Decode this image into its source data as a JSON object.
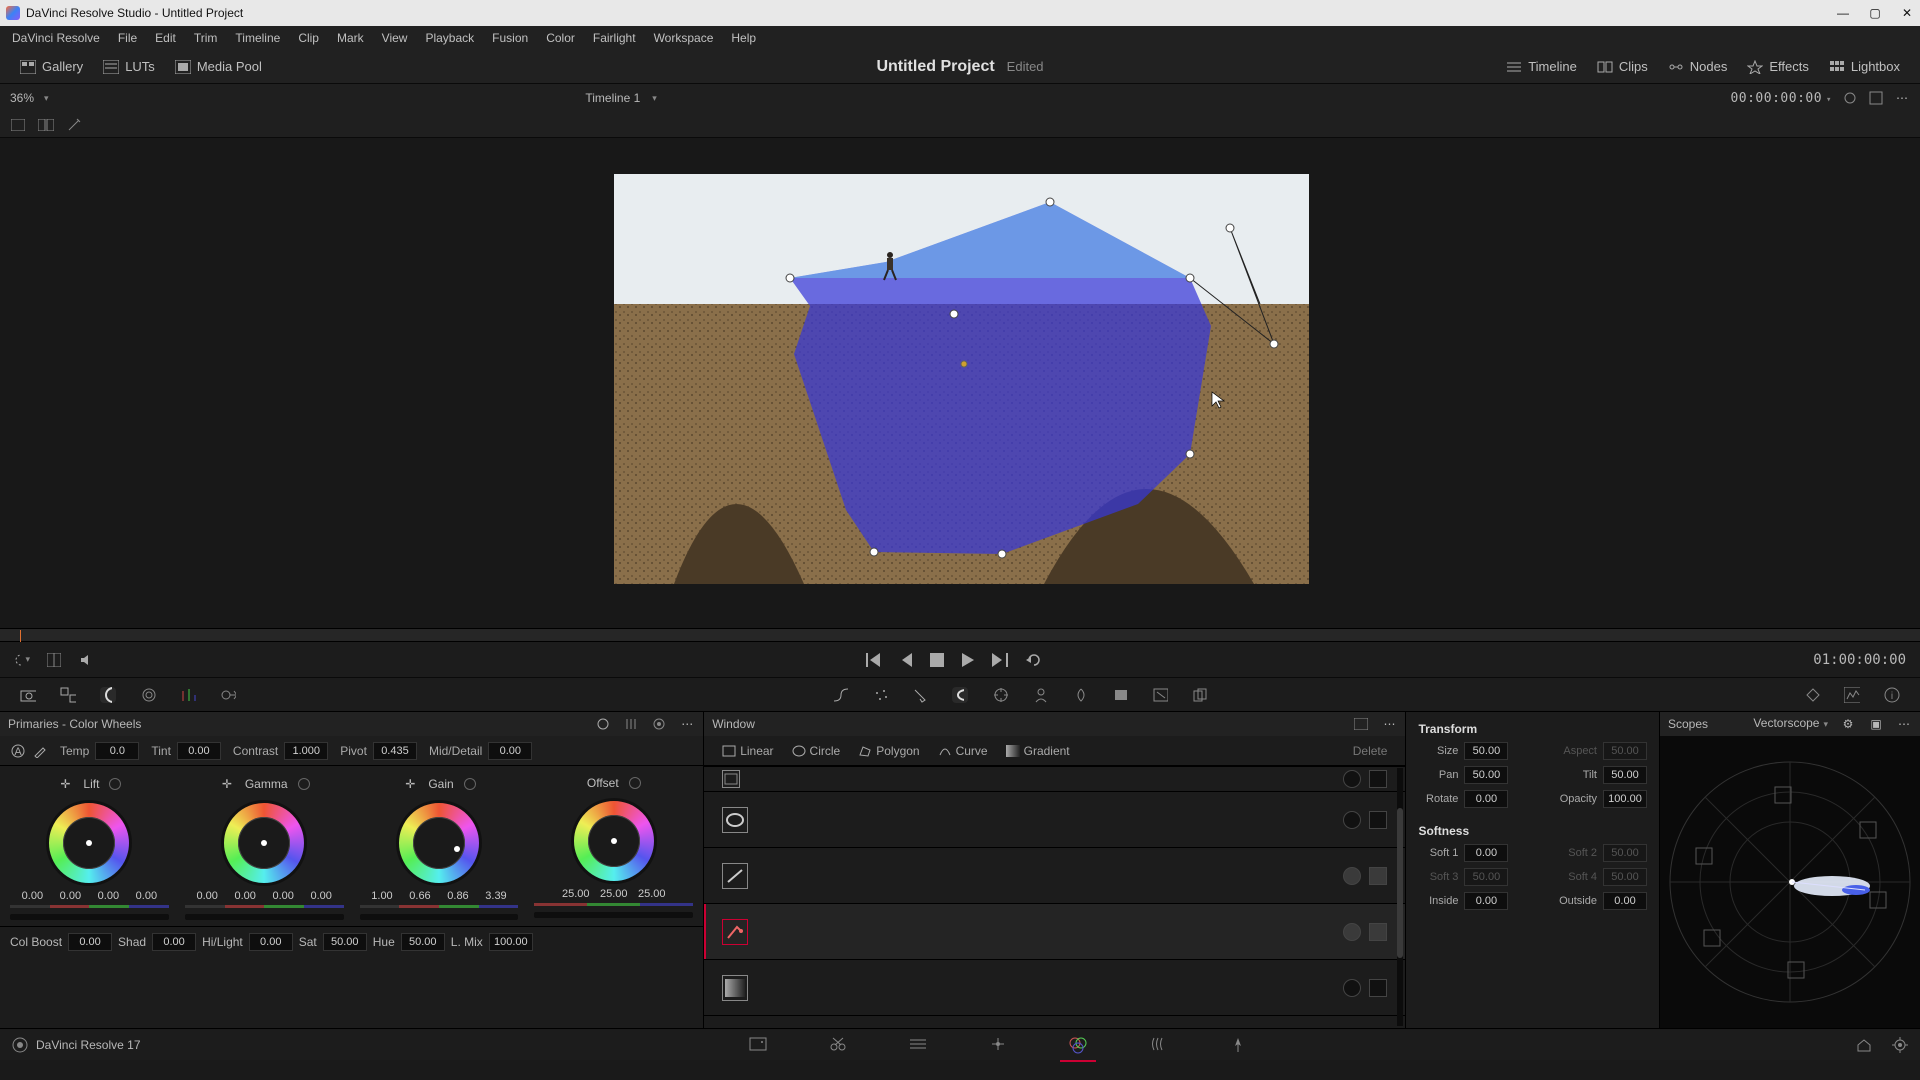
{
  "titlebar": {
    "text": "DaVinci Resolve Studio - Untitled Project"
  },
  "menu": [
    "DaVinci Resolve",
    "File",
    "Edit",
    "Trim",
    "Timeline",
    "Clip",
    "Mark",
    "View",
    "Playback",
    "Fusion",
    "Color",
    "Fairlight",
    "Workspace",
    "Help"
  ],
  "toolrow": {
    "left": [
      {
        "label": "Gallery",
        "icon": "gallery-icon"
      },
      {
        "label": "LUTs",
        "icon": "luts-icon"
      },
      {
        "label": "Media Pool",
        "icon": "mediapool-icon"
      }
    ],
    "project": {
      "name": "Untitled Project",
      "state": "Edited"
    },
    "right": [
      {
        "label": "Timeline",
        "icon": "timeline-icon"
      },
      {
        "label": "Clips",
        "icon": "clips-icon"
      },
      {
        "label": "Nodes",
        "icon": "nodes-icon"
      },
      {
        "label": "Effects",
        "icon": "effects-icon"
      },
      {
        "label": "Lightbox",
        "icon": "lightbox-icon"
      }
    ]
  },
  "zoomrow": {
    "zoom": "36%",
    "timeline": "Timeline 1",
    "tc": "00:00:00:00"
  },
  "transport": {
    "tc": "01:00:00:00"
  },
  "primaries": {
    "title": "Primaries - Color Wheels",
    "adjust1": [
      {
        "label": "Temp",
        "val": "0.0"
      },
      {
        "label": "Tint",
        "val": "0.00"
      },
      {
        "label": "Contrast",
        "val": "1.000"
      },
      {
        "label": "Pivot",
        "val": "0.435"
      },
      {
        "label": "Mid/Detail",
        "val": "0.00"
      }
    ],
    "wheels": [
      {
        "name": "Lift",
        "nums": [
          "0.00",
          "0.00",
          "0.00",
          "0.00"
        ]
      },
      {
        "name": "Gamma",
        "nums": [
          "0.00",
          "0.00",
          "0.00",
          "0.00"
        ]
      },
      {
        "name": "Gain",
        "nums": [
          "1.00",
          "0.66",
          "0.86",
          "3.39"
        ]
      },
      {
        "name": "Offset",
        "nums": [
          "25.00",
          "25.00",
          "25.00"
        ]
      }
    ],
    "adjust2": [
      {
        "label": "Col Boost",
        "val": "0.00"
      },
      {
        "label": "Shad",
        "val": "0.00"
      },
      {
        "label": "Hi/Light",
        "val": "0.00"
      },
      {
        "label": "Sat",
        "val": "50.00"
      },
      {
        "label": "Hue",
        "val": "50.00"
      },
      {
        "label": "L. Mix",
        "val": "100.00"
      }
    ]
  },
  "window": {
    "title": "Window",
    "shapes": [
      "Linear",
      "Circle",
      "Polygon",
      "Curve",
      "Gradient"
    ],
    "delete": "Delete"
  },
  "transform": {
    "h": "Transform",
    "rows": [
      [
        {
          "l": "Size",
          "v": "50.00"
        },
        {
          "l": "Aspect",
          "v": "50.00",
          "dim": true
        }
      ],
      [
        {
          "l": "Pan",
          "v": "50.00"
        },
        {
          "l": "Tilt",
          "v": "50.00"
        }
      ],
      [
        {
          "l": "Rotate",
          "v": "0.00"
        },
        {
          "l": "Opacity",
          "v": "100.00"
        }
      ]
    ],
    "soft_h": "Softness",
    "soft": [
      [
        {
          "l": "Soft 1",
          "v": "0.00"
        },
        {
          "l": "Soft 2",
          "v": "50.00",
          "dim": true
        }
      ],
      [
        {
          "l": "Soft 3",
          "v": "50.00",
          "dim": true
        },
        {
          "l": "Soft 4",
          "v": "50.00",
          "dim": true
        }
      ],
      [
        {
          "l": "Inside",
          "v": "0.00"
        },
        {
          "l": "Outside",
          "v": "0.00"
        }
      ]
    ]
  },
  "scopes": {
    "title": "Scopes",
    "type": "Vectorscope"
  },
  "footer": {
    "app": "DaVinci Resolve 17"
  }
}
